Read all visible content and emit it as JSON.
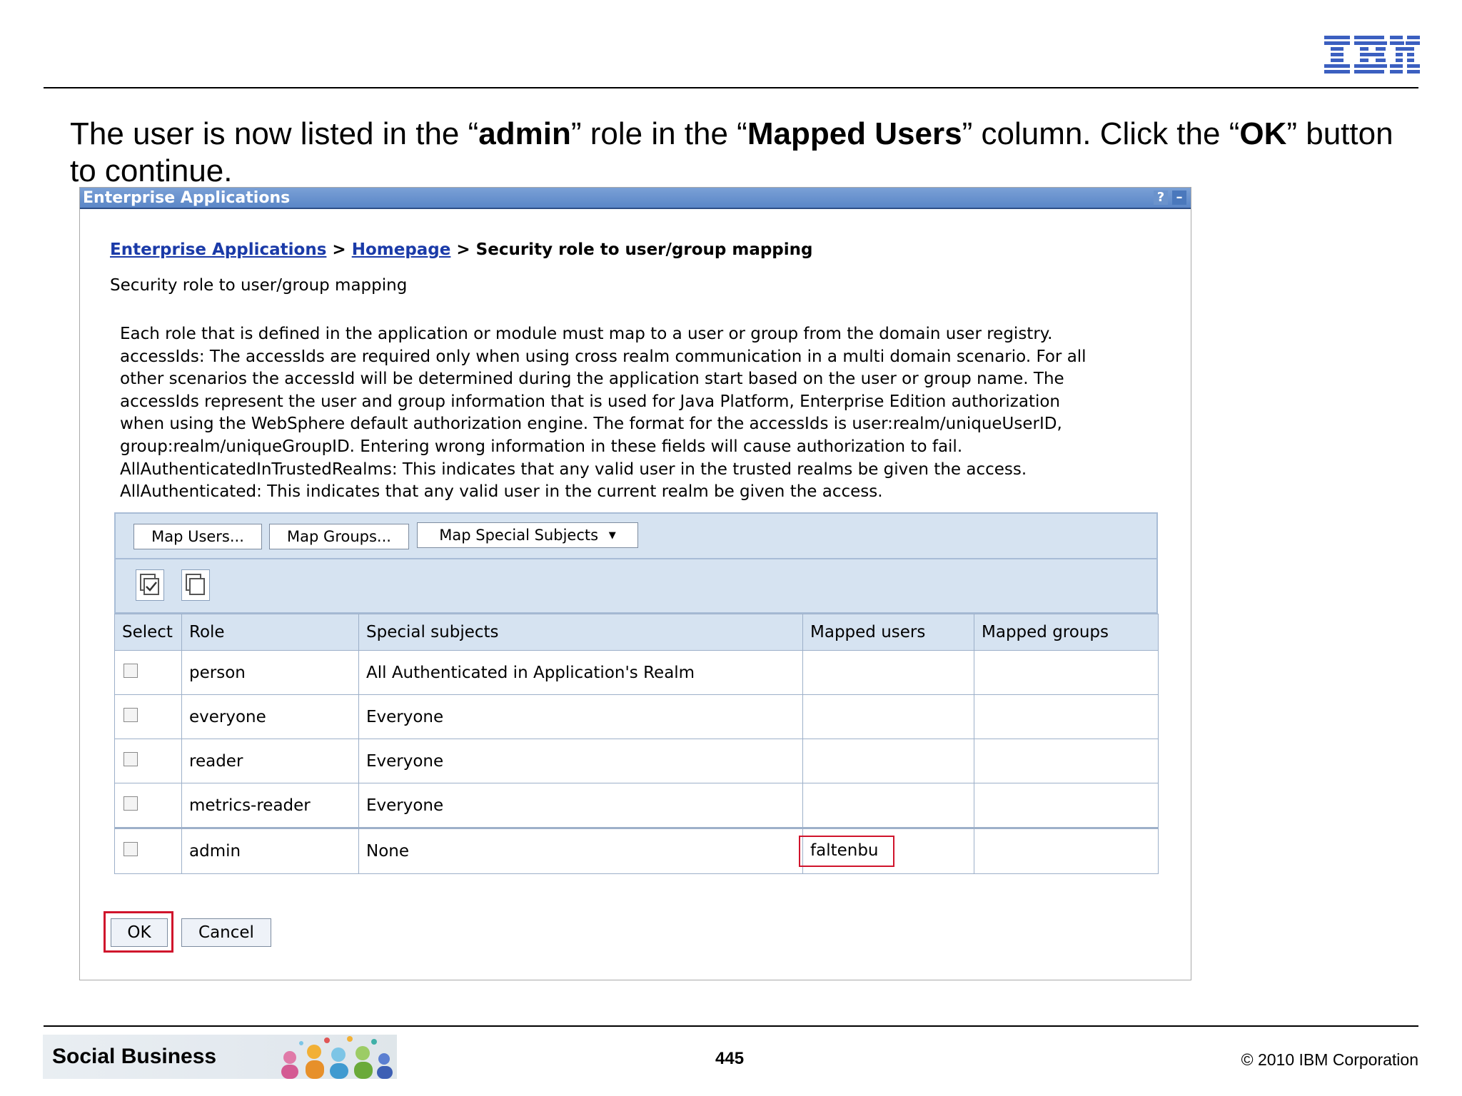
{
  "slide": {
    "instruction": {
      "p1": "The user is now listed in the “",
      "b1": "admin",
      "p2": "” role in the “",
      "b2": "Mapped Users",
      "p3": "” column. Click the “",
      "b3": "OK",
      "p4": "” button to continue."
    },
    "logo": "IBM",
    "footer": {
      "banner_label": "Social Business",
      "page_number": "445",
      "copyright": "© 2010 IBM Corporation"
    }
  },
  "window": {
    "title": "Enterprise Applications",
    "help_label": "?",
    "minimize_label": "–"
  },
  "breadcrumb": {
    "link1": "Enterprise Applications",
    "sep1": " > ",
    "link2": "Homepage",
    "sep2": " > ",
    "current": "Security role to user/group mapping"
  },
  "page_heading": "Security role to user/group mapping",
  "description_lines": [
    "Each role that is defined in the application or module must map to a user or group from the domain user registry.",
    "accessIds: The accessIds are required only when using cross realm communication in a multi domain scenario. For all",
    "other scenarios the accessId will be determined during the application start based on the user or group name. The",
    "accessIds represent the user and group information that is used for Java Platform, Enterprise Edition authorization",
    "when using the WebSphere default authorization engine. The format for the accessIds is user:realm/uniqueUserID,",
    "group:realm/uniqueGroupID. Entering wrong information in these fields will cause authorization to fail.",
    "AllAuthenticatedInTrustedRealms: This indicates that any valid user in the trusted realms be given the access.",
    "AllAuthenticated: This indicates that any valid user in the current realm be given the access."
  ],
  "toolbar": {
    "map_users": "Map Users...",
    "map_groups": "Map Groups...",
    "map_special": "Map Special Subjects",
    "dropdown_arrow": "▼"
  },
  "table": {
    "headers": [
      "Select",
      "Role",
      "Special subjects",
      "Mapped users",
      "Mapped groups"
    ],
    "rows": [
      {
        "role": "person",
        "special": "All Authenticated in Application's Realm",
        "users": "",
        "groups": ""
      },
      {
        "role": "everyone",
        "special": "Everyone",
        "users": "",
        "groups": ""
      },
      {
        "role": "reader",
        "special": "Everyone",
        "users": "",
        "groups": ""
      },
      {
        "role": "metrics-reader",
        "special": "Everyone",
        "users": "",
        "groups": ""
      },
      {
        "role": "admin",
        "special": "None",
        "users": "faltenbu",
        "groups": ""
      }
    ]
  },
  "actions": {
    "ok": "OK",
    "cancel": "Cancel"
  },
  "colors": {
    "title_bar": "#5a86c7",
    "link": "#1a3aa8",
    "highlight": "#d0142c",
    "table_header": "#d6e3f1"
  }
}
